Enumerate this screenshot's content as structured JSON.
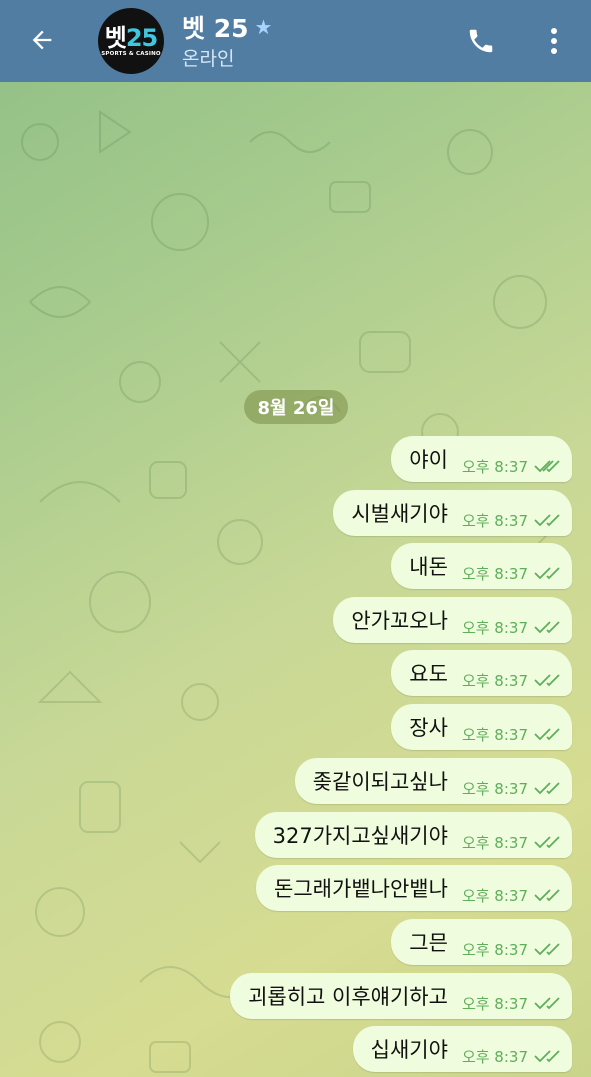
{
  "header": {
    "title": "벳 25",
    "status": "온라인",
    "avatar": {
      "logo_prefix": "벳",
      "logo_number": "25",
      "logo_subtitle": "SPORTS & CASINO"
    },
    "icons": {
      "back": "arrow-left-icon",
      "verified": "star-icon",
      "call": "phone-icon",
      "menu": "more-vertical-icon"
    },
    "colors": {
      "bar": "#517da2"
    }
  },
  "chat": {
    "date_label": "8월 26일",
    "messages": [
      {
        "text": "야이",
        "time": "오후 8:37",
        "status": "read"
      },
      {
        "text": "시벌새기야",
        "time": "오후 8:37",
        "status": "read"
      },
      {
        "text": "내돈",
        "time": "오후 8:37",
        "status": "read"
      },
      {
        "text": "안가꼬오나",
        "time": "오후 8:37",
        "status": "read"
      },
      {
        "text": "요도",
        "time": "오후 8:37",
        "status": "read"
      },
      {
        "text": "장사",
        "time": "오후 8:37",
        "status": "read"
      },
      {
        "text": "좆같이되고싶나",
        "time": "오후 8:37",
        "status": "read"
      },
      {
        "text": "327가지고싶새기야",
        "time": "오후 8:37",
        "status": "read"
      },
      {
        "text": "돈그래가뱉나안뱉나",
        "time": "오후 8:37",
        "status": "read"
      },
      {
        "text": "그믄",
        "time": "오후 8:37",
        "status": "read"
      },
      {
        "text": "괴롭히고 이후얘기하고",
        "time": "오후 8:37",
        "status": "read"
      },
      {
        "text": "십새기야",
        "time": "오후 8:37",
        "status": "read"
      }
    ],
    "colors": {
      "bubble": "#effdde",
      "meta": "#5fae5a"
    }
  }
}
